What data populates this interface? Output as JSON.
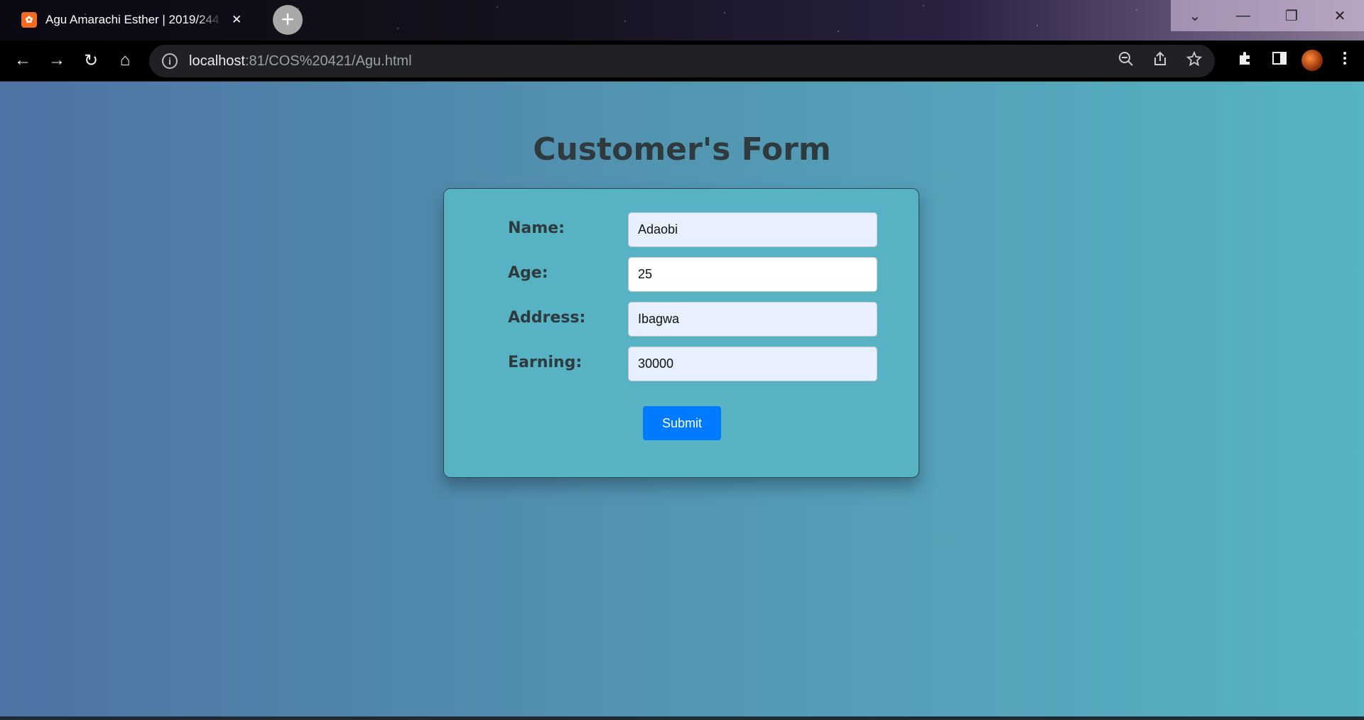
{
  "browser": {
    "tab": {
      "title": "Agu Amarachi Esther | 2019/244",
      "favicon_icon": "xampp-icon",
      "close_glyph": "✕"
    },
    "new_tab_glyph": "+",
    "url": {
      "host": "localhost",
      "rest": ":81/COS%20421/Agu.html"
    },
    "nav": {
      "back_icon": "←",
      "forward_icon": "→",
      "reload_icon": "↻",
      "home_icon": "⌂"
    },
    "omnibox_icons": [
      "zoom-out-icon",
      "share-icon",
      "star-icon"
    ],
    "toolbar_icons": [
      "extensions-icon",
      "side-panel-icon",
      "profile-avatar",
      "menu-icon"
    ],
    "window_controls": [
      "⌄",
      "—",
      "❐",
      "✕"
    ]
  },
  "page": {
    "title": "Customer's Form",
    "form": {
      "fields": [
        {
          "label": "Name:",
          "value": "Adaobi"
        },
        {
          "label": "Age:",
          "value": "25"
        },
        {
          "label": "Address:",
          "value": "Ibagwa"
        },
        {
          "label": "Earning:",
          "value": "30000"
        }
      ],
      "submit_label": "Submit"
    }
  },
  "colors": {
    "submit_button": "#007bff",
    "card_background": "#57b3c3",
    "title_text": "#2e3a3e",
    "autofill_input": "#e8f0fe"
  }
}
